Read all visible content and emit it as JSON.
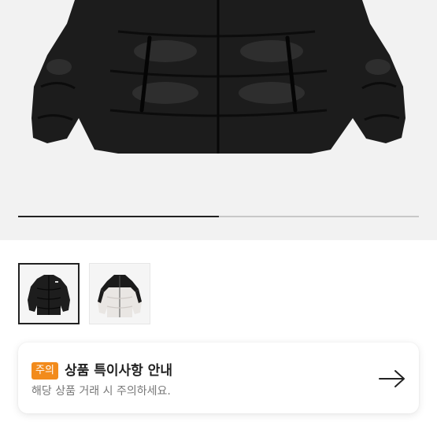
{
  "gallery": {
    "image_count": 2,
    "current_index": 0,
    "thumbnails": [
      {
        "icon": "black-puffer-jacket",
        "selected": true
      },
      {
        "icon": "white-black-puffer-jacket",
        "selected": false
      }
    ]
  },
  "notice": {
    "badge": "주의",
    "title": "상품 특이사항 안내",
    "description": "해당 상품 거래 시 주의하세요.",
    "badge_color": "#f28b1c"
  }
}
